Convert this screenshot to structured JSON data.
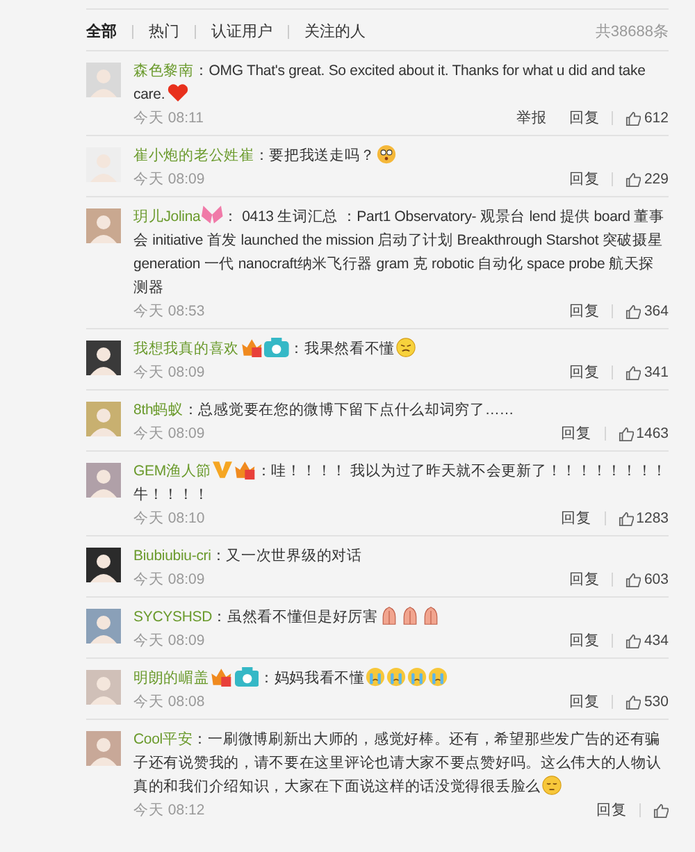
{
  "tabs": [
    {
      "label": "全部",
      "selected": true
    },
    {
      "label": "热门",
      "selected": false
    },
    {
      "label": "认证用户",
      "selected": false
    },
    {
      "label": "关注的人",
      "selected": false
    }
  ],
  "total": "共38688条",
  "comments": [
    {
      "user": "森色黎南",
      "text": "：OMG That's great. So excited about it. Thanks for what u did and take care.",
      "emoji": [
        {
          "kind": "heart"
        }
      ],
      "time": "今天 08:11",
      "actions": [
        "举报",
        "回复"
      ],
      "likes": "612"
    },
    {
      "user": "崔小炮的老公姓崔",
      "text": "：要把我送走吗？",
      "emoji": [
        {
          "kind": "shocked"
        }
      ],
      "time": "今天 08:09",
      "actions": [
        "回复"
      ],
      "likes": "229"
    },
    {
      "user": "玥儿Jolina",
      "badges": [
        {
          "kind": "butterfly"
        }
      ],
      "text": "： 0413 生词汇总 ：Part1  Observatory- 观景台 lend 提供 board 董事会 initiative 首发 launched the mission 启动了计划 Breakthrough Starshot 突破摄星 generation 一代 nanocraft纳米飞行器 gram 克 robotic 自动化 space probe 航天探测器",
      "time": "今天 08:53",
      "actions": [
        "回复"
      ],
      "likes": "364"
    },
    {
      "user": "我想我真的喜欢",
      "badges": [
        {
          "kind": "crown"
        },
        {
          "kind": "camera"
        }
      ],
      "text": "：我果然看不懂",
      "emoji": [
        {
          "kind": "confused"
        }
      ],
      "time": "今天 08:09",
      "actions": [
        "回复"
      ],
      "likes": "341"
    },
    {
      "user": "8th蚂蚁",
      "text": "：总感觉要在您的微博下留下点什么却词穷了……",
      "time": "今天 08:09",
      "actions": [
        "回复"
      ],
      "likes": "1463"
    },
    {
      "user": "GEM渔人節",
      "badges": [
        {
          "kind": "vip"
        },
        {
          "kind": "crown"
        }
      ],
      "text": "：哇！！！！ 我以为过了昨天就不会更新了！！！！！！！！牛！！！！",
      "time": "今天 08:10",
      "actions": [
        "回复"
      ],
      "likes": "1283"
    },
    {
      "user": "Biubiubiu-cri",
      "text": "：又一次世界级的对话",
      "time": "今天 08:09",
      "actions": [
        "回复"
      ],
      "likes": "603"
    },
    {
      "user": "SYCYSHSD",
      "text": "：虽然看不懂但是好厉害",
      "emoji": [
        {
          "kind": "pray"
        },
        {
          "kind": "pray"
        },
        {
          "kind": "pray"
        }
      ],
      "time": "今天 08:09",
      "actions": [
        "回复"
      ],
      "likes": "434"
    },
    {
      "user": "明朗的嵋盖",
      "badges": [
        {
          "kind": "crown"
        },
        {
          "kind": "camera"
        }
      ],
      "text": "：妈妈我看不懂",
      "emoji": [
        {
          "kind": "crying"
        },
        {
          "kind": "crying"
        },
        {
          "kind": "crying"
        },
        {
          "kind": "crying"
        }
      ],
      "time": "今天 08:08",
      "actions": [
        "回复"
      ],
      "likes": "530"
    },
    {
      "user": "Cool平安",
      "text": "：一刷微博刷新出大师的，感觉好棒。还有，希望那些发广告的还有骗子还有说赞我的，请不要在这里评论也请大家不要点赞好吗。这么伟大的人物认真的和我们介绍知识，大家在下面说这样的话没觉得很丢脸么",
      "emoji": [
        {
          "kind": "sad"
        }
      ],
      "time": "今天 08:12",
      "actions": [
        "回复"
      ]
    }
  ]
}
